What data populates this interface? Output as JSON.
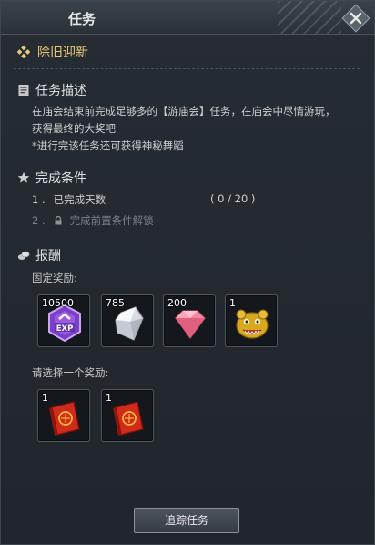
{
  "window": {
    "title": "任务"
  },
  "quest": {
    "name": "除旧迎新"
  },
  "description": {
    "heading": "任务描述",
    "lines": [
      "在庙会结束前完成足够多的【游庙会】任务，在庙会中尽情游玩，",
      "获得最终的大奖吧",
      "*进行完该任务还可获得神秘舞蹈"
    ]
  },
  "conditions": {
    "heading": "完成条件",
    "items": [
      {
        "number": "1 .",
        "text": "已完成天数",
        "progress": "( 0 / 20 )"
      },
      {
        "number": "2 .",
        "text": "完成前置条件解锁"
      }
    ]
  },
  "rewards": {
    "heading": "报酬",
    "fixed_label": "固定奖励:",
    "fixed": [
      {
        "qty": "10500",
        "icon": "exp-icon"
      },
      {
        "qty": "785",
        "icon": "silver-crystal-icon"
      },
      {
        "qty": "200",
        "icon": "pink-gem-icon"
      },
      {
        "qty": "1",
        "icon": "golden-lion-icon"
      }
    ],
    "choice_label": "请选择一个奖励:",
    "choice": [
      {
        "qty": "1",
        "icon": "red-book-icon"
      },
      {
        "qty": "1",
        "icon": "red-book-icon"
      }
    ]
  },
  "footer": {
    "track_button": "追踪任务"
  },
  "colors": {
    "accent_gold": "#e8c97a",
    "panel_bg": "#20262c"
  }
}
